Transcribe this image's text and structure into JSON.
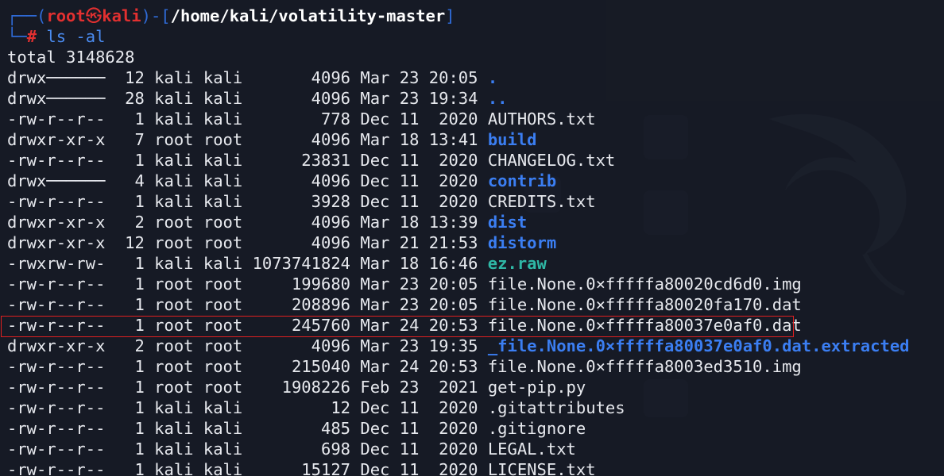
{
  "prompt": {
    "frame_top_left": "┌──(",
    "user": "root",
    "at_symbol": "㉿",
    "host": "kali",
    "frame_mid": ")-[",
    "path": "/home/kali/volatility-master",
    "frame_close": "]",
    "frame_bottom": "└─",
    "hash": "#",
    "command": " ls -al"
  },
  "total_line": "total 3148628",
  "listing": [
    {
      "perms": "drwx──────",
      "links": "12",
      "owner": "kali",
      "group": "kali",
      "size": "4096",
      "date": "Mar 23 20:05",
      "name": ".",
      "type": "dir"
    },
    {
      "perms": "drwx──────",
      "links": "28",
      "owner": "kali",
      "group": "kali",
      "size": "4096",
      "date": "Mar 23 19:34",
      "name": "..",
      "type": "dir"
    },
    {
      "perms": "-rw-r--r--",
      "links": "1",
      "owner": "kali",
      "group": "kali",
      "size": "778",
      "date": "Dec 11  2020",
      "name": "AUTHORS.txt",
      "type": "file"
    },
    {
      "perms": "drwxr-xr-x",
      "links": "7",
      "owner": "root",
      "group": "root",
      "size": "4096",
      "date": "Mar 18 13:41",
      "name": "build",
      "type": "dir"
    },
    {
      "perms": "-rw-r--r--",
      "links": "1",
      "owner": "kali",
      "group": "kali",
      "size": "23831",
      "date": "Dec 11  2020",
      "name": "CHANGELOG.txt",
      "type": "file"
    },
    {
      "perms": "drwx──────",
      "links": "4",
      "owner": "kali",
      "group": "kali",
      "size": "4096",
      "date": "Dec 11  2020",
      "name": "contrib",
      "type": "dir"
    },
    {
      "perms": "-rw-r--r--",
      "links": "1",
      "owner": "kali",
      "group": "kali",
      "size": "3928",
      "date": "Dec 11  2020",
      "name": "CREDITS.txt",
      "type": "file"
    },
    {
      "perms": "drwxr-xr-x",
      "links": "2",
      "owner": "root",
      "group": "root",
      "size": "4096",
      "date": "Mar 18 13:39",
      "name": "dist",
      "type": "dir"
    },
    {
      "perms": "drwxr-xr-x",
      "links": "12",
      "owner": "root",
      "group": "root",
      "size": "4096",
      "date": "Mar 21 21:53",
      "name": "distorm",
      "type": "dir"
    },
    {
      "perms": "-rwxrw-rw-",
      "links": "1",
      "owner": "kali",
      "group": "kali",
      "size": "1073741824",
      "date": "Mar 18 16:46",
      "name": "ez.raw",
      "type": "exec"
    },
    {
      "perms": "-rw-r--r--",
      "links": "1",
      "owner": "root",
      "group": "root",
      "size": "199680",
      "date": "Mar 23 20:05",
      "name": "file.None.0×fffffa80020cd6d0.img",
      "type": "file"
    },
    {
      "perms": "-rw-r--r--",
      "links": "1",
      "owner": "root",
      "group": "root",
      "size": "208896",
      "date": "Mar 23 20:05",
      "name": "file.None.0×fffffa80020fa170.dat",
      "type": "file"
    },
    {
      "perms": "-rw-r--r--",
      "links": "1",
      "owner": "root",
      "group": "root",
      "size": "245760",
      "date": "Mar 24 20:53",
      "name": "file.None.0×fffffa80037e0af0.dat",
      "type": "file",
      "highlighted": true
    },
    {
      "perms": "drwxr-xr-x",
      "links": "2",
      "owner": "root",
      "group": "root",
      "size": "4096",
      "date": "Mar 23 19:35",
      "name": "_file.None.0×fffffa80037e0af0.dat.extracted",
      "type": "dir"
    },
    {
      "perms": "-rw-r--r--",
      "links": "1",
      "owner": "root",
      "group": "root",
      "size": "215040",
      "date": "Mar 24 20:53",
      "name": "file.None.0×fffffa8003ed3510.img",
      "type": "file"
    },
    {
      "perms": "-rw-r--r--",
      "links": "1",
      "owner": "root",
      "group": "root",
      "size": "1908226",
      "date": "Feb 23  2021",
      "name": "get-pip.py",
      "type": "file"
    },
    {
      "perms": "-rw-r--r--",
      "links": "1",
      "owner": "kali",
      "group": "kali",
      "size": "12",
      "date": "Dec 11  2020",
      "name": ".gitattributes",
      "type": "file"
    },
    {
      "perms": "-rw-r--r--",
      "links": "1",
      "owner": "kali",
      "group": "kali",
      "size": "485",
      "date": "Dec 11  2020",
      "name": ".gitignore",
      "type": "file"
    },
    {
      "perms": "-rw-r--r--",
      "links": "1",
      "owner": "kali",
      "group": "kali",
      "size": "698",
      "date": "Dec 11  2020",
      "name": "LEGAL.txt",
      "type": "file"
    },
    {
      "perms": "-rw-r--r--",
      "links": "1",
      "owner": "kali",
      "group": "kali",
      "size": "15127",
      "date": "Dec 11  2020",
      "name": "LICENSE.txt",
      "type": "file"
    }
  ],
  "colors": {
    "background": "#1b1f2a",
    "prompt_frame": "#2f6bd8",
    "prompt_user": "#e23030",
    "directory": "#3b7ef2",
    "executable": "#2fb8a6",
    "highlight_border": "#e02020"
  }
}
